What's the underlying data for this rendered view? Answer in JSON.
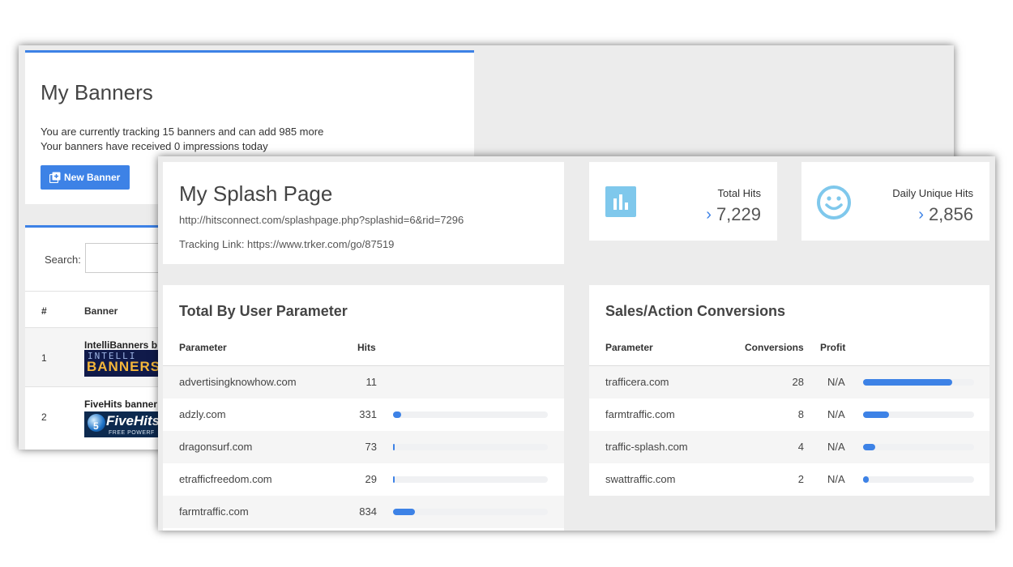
{
  "banners_window": {
    "title": "My Banners",
    "line1": "You are currently tracking 15 banners and can add 985 more",
    "line2": "Your banners have received 0 impressions today",
    "new_button": "New Banner",
    "search_label": "Search:",
    "columns": {
      "num": "#",
      "banner": "Banner"
    },
    "rows": [
      {
        "num": "1",
        "name": "IntelliBanners b",
        "image_text_top": "INTELLI",
        "image_text_main": "BANNERS"
      },
      {
        "num": "2",
        "name": "FiveHits banner",
        "image_text_main": "FiveHits",
        "image_badge": "5",
        "image_sub": "FREE POWERF"
      }
    ]
  },
  "splash": {
    "title": "My Splash Page",
    "url": "http://hitsconnect.com/splashpage.php?splashid=6&rid=7296",
    "tracking": "Tracking Link: https://www.trker.com/go/87519"
  },
  "stats": {
    "total_hits": {
      "label": "Total Hits",
      "value": "7,229",
      "icon": "bar-chart-icon"
    },
    "daily_unique": {
      "label": "Daily Unique Hits",
      "value": "2,856",
      "icon": "smiley-icon"
    }
  },
  "user_param": {
    "title": "Total By User Parameter",
    "columns": {
      "parameter": "Parameter",
      "hits": "Hits"
    },
    "rows": [
      {
        "parameter": "advertisingknowhow.com",
        "hits": "11",
        "fraction": 0.0
      },
      {
        "parameter": "adzly.com",
        "hits": "331",
        "fraction": 0.05
      },
      {
        "parameter": "dragonsurf.com",
        "hits": "73",
        "fraction": 0.01
      },
      {
        "parameter": "etrafficfreedom.com",
        "hits": "29",
        "fraction": 0.005
      },
      {
        "parameter": "farmtraffic.com",
        "hits": "834",
        "fraction": 0.14
      }
    ]
  },
  "conversions": {
    "title": "Sales/Action Conversions",
    "columns": {
      "parameter": "Parameter",
      "conversions": "Conversions",
      "profit": "Profit"
    },
    "rows": [
      {
        "parameter": "trafficera.com",
        "conversions": "28",
        "profit": "N/A",
        "fraction": 0.8
      },
      {
        "parameter": "farmtraffic.com",
        "conversions": "8",
        "profit": "N/A",
        "fraction": 0.23
      },
      {
        "parameter": "traffic-splash.com",
        "conversions": "4",
        "profit": "N/A",
        "fraction": 0.11
      },
      {
        "parameter": "swattraffic.com",
        "conversions": "2",
        "profit": "N/A",
        "fraction": 0.05
      }
    ]
  },
  "colors": {
    "accent": "#3d82e6",
    "icon_blue": "#7fc8ec",
    "panel_bg": "#ececec"
  }
}
